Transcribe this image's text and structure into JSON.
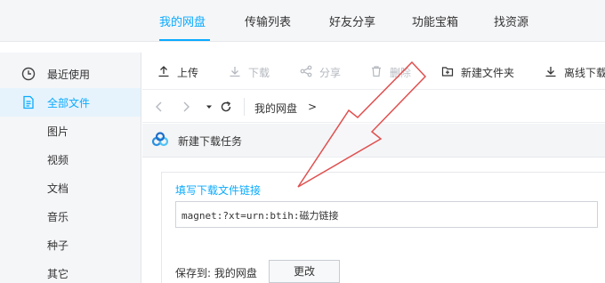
{
  "topnav": {
    "tabs": [
      {
        "label": "我的网盘",
        "active": true
      },
      {
        "label": "传输列表",
        "active": false
      },
      {
        "label": "好友分享",
        "active": false
      },
      {
        "label": "功能宝箱",
        "active": false
      },
      {
        "label": "找资源",
        "active": false
      }
    ]
  },
  "sidebar": {
    "items": [
      {
        "label": "最近使用",
        "icon": "clock-icon",
        "active": false
      },
      {
        "label": "全部文件",
        "icon": "file-icon",
        "active": true
      },
      {
        "label": "图片",
        "active": false
      },
      {
        "label": "视频",
        "active": false
      },
      {
        "label": "文档",
        "active": false
      },
      {
        "label": "音乐",
        "active": false
      },
      {
        "label": "种子",
        "active": false
      },
      {
        "label": "其它",
        "active": false
      }
    ]
  },
  "toolbar": {
    "upload": "上传",
    "download": "下载",
    "share": "分享",
    "delete": "删除",
    "new_folder": "新建文件夹",
    "offline_download": "离线下载"
  },
  "breadcrumb": {
    "root": "我的网盘",
    "arrow": ">"
  },
  "dialog": {
    "title": "新建下载任务",
    "field_label": "填写下载文件链接",
    "link_value": "magnet:?xt=urn:btih:磁力链接",
    "save_to_label": "保存到: 我的网盘",
    "change_button": "更改"
  },
  "colors": {
    "accent": "#09aaff",
    "annotation": "#e0504f"
  }
}
